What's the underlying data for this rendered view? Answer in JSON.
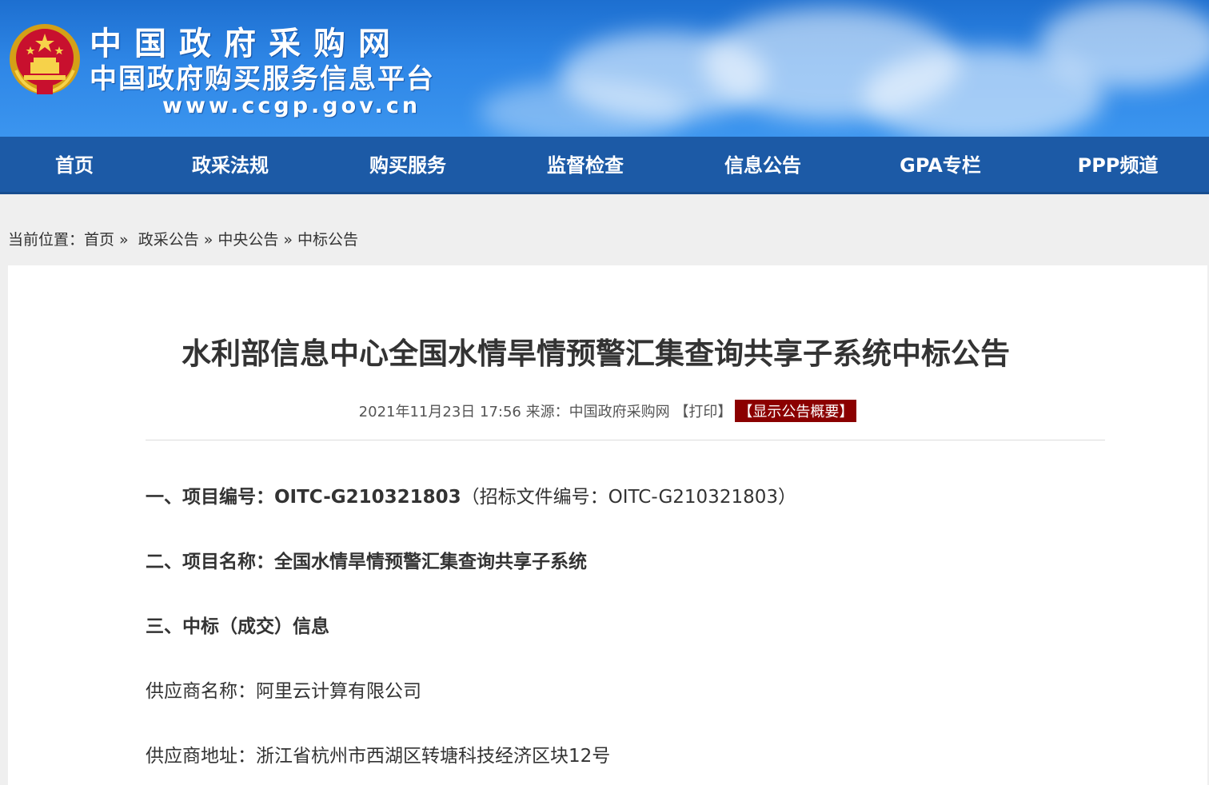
{
  "header": {
    "site_title": "中国政府采购网",
    "site_subtitle": "中国政府购买服务信息平台",
    "site_url": "www.ccgp.gov.cn"
  },
  "nav": {
    "items": [
      "首页",
      "政采法规",
      "购买服务",
      "监督检查",
      "信息公告",
      "GPA专栏",
      "PPP频道"
    ]
  },
  "breadcrumb": {
    "prefix": "当前位置：",
    "items": [
      "首页",
      "政采公告",
      "中央公告",
      "中标公告"
    ],
    "separator": "»"
  },
  "article": {
    "title": "水利部信息中心全国水情旱情预警汇集查询共享子系统中标公告",
    "meta_text": "2021年11月23日 17:56 来源：中国政府采购网 ",
    "print_label": "【打印】",
    "summary_label": "【显示公告概要】",
    "sections": [
      {
        "label": "一、项目编号：",
        "value": "OITC-G210321803",
        "note": "（招标文件编号：OITC-G210321803）"
      },
      {
        "label": "二、项目名称：",
        "value": "全国水情旱情预警汇集查询共享子系统"
      },
      {
        "label": "三、中标（成交）信息"
      }
    ],
    "supplier_name_label": "供应商名称：",
    "supplier_name": "阿里云计算有限公司",
    "supplier_address_label": "供应商地址：",
    "supplier_address": "浙江省杭州市西湖区转塘科技经济区块12号"
  },
  "colors": {
    "nav_bg": "#1c5aa6",
    "banner_bg": "#2e86e6",
    "summary_bg": "#8b0000"
  }
}
